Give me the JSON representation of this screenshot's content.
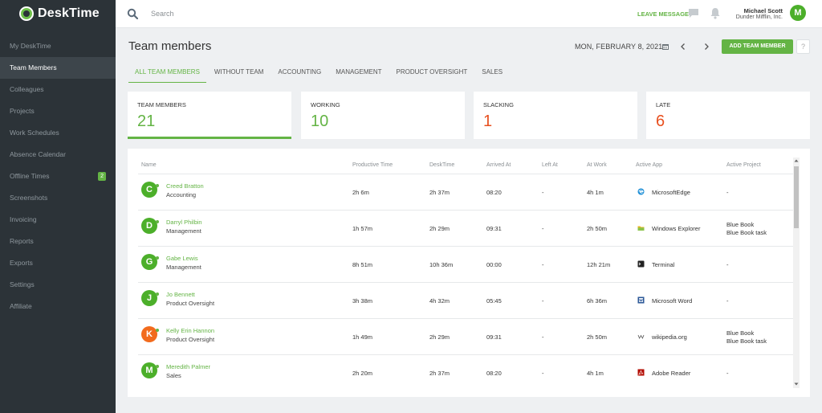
{
  "app": {
    "name": "DeskTime"
  },
  "sidebar": {
    "items": [
      {
        "label": "My DeskTime"
      },
      {
        "label": "Team Members"
      },
      {
        "label": "Colleagues"
      },
      {
        "label": "Projects"
      },
      {
        "label": "Work Schedules"
      },
      {
        "label": "Absence Calendar"
      },
      {
        "label": "Offline Times",
        "badge": "2"
      },
      {
        "label": "Screenshots"
      },
      {
        "label": "Invoicing"
      },
      {
        "label": "Reports"
      },
      {
        "label": "Exports"
      },
      {
        "label": "Settings"
      },
      {
        "label": "Affiliate"
      }
    ]
  },
  "topbar": {
    "search_placeholder": "Search",
    "leave_message": "LEAVE MESSAGE",
    "user_name": "Michael Scott",
    "user_company": "Dunder Mifflin, Inc.",
    "user_initial": "M"
  },
  "header": {
    "title": "Team members",
    "date": "MON, FEBRUARY 8, 2021",
    "add_button": "ADD TEAM MEMBER",
    "help": "?"
  },
  "tabs": [
    {
      "label": "ALL TEAM MEMBERS"
    },
    {
      "label": "WITHOUT TEAM"
    },
    {
      "label": "ACCOUNTING"
    },
    {
      "label": "MANAGEMENT"
    },
    {
      "label": "PRODUCT OVERSIGHT"
    },
    {
      "label": "SALES"
    }
  ],
  "stats": [
    {
      "label": "TEAM MEMBERS",
      "value": "21",
      "color": "#64b445"
    },
    {
      "label": "WORKING",
      "value": "10",
      "color": "#64b445"
    },
    {
      "label": "SLACKING",
      "value": "1",
      "color": "#e8501f"
    },
    {
      "label": "LATE",
      "value": "6",
      "color": "#e8501f"
    }
  ],
  "table": {
    "columns": [
      "Name",
      "Productive Time",
      "DeskTime",
      "Arrived At",
      "Left At",
      "At Work",
      "Active App",
      "Active Project"
    ],
    "rows": [
      {
        "initial": "C",
        "avatar_color": "#4caf2a",
        "name": "Creed Bratton",
        "team": "Accounting",
        "productive": "2h 6m",
        "desktime": "2h 37m",
        "arrived": "08:20",
        "left": "-",
        "at_work": "4h 1m",
        "app_icon": "edge-icon",
        "app": "MicrosoftEdge",
        "project": [
          "-"
        ]
      },
      {
        "initial": "D",
        "avatar_color": "#4caf2a",
        "name": "Darryl Philbin",
        "team": "Management",
        "productive": "1h 57m",
        "desktime": "2h 29m",
        "arrived": "09:31",
        "left": "-",
        "at_work": "2h 50m",
        "app_icon": "explorer-icon",
        "app": "Windows Explorer",
        "project": [
          "Blue Book",
          "Blue Book task"
        ]
      },
      {
        "initial": "G",
        "avatar_color": "#4caf2a",
        "name": "Gabe Lewis",
        "team": "Management",
        "productive": "8h 51m",
        "desktime": "10h 36m",
        "arrived": "00:00",
        "left": "-",
        "at_work": "12h 21m",
        "app_icon": "terminal-icon",
        "app": "Terminal",
        "project": [
          "-"
        ]
      },
      {
        "initial": "J",
        "avatar_color": "#4caf2a",
        "name": "Jo Bennett",
        "team": "Product Oversight",
        "productive": "3h 38m",
        "desktime": "4h 32m",
        "arrived": "05:45",
        "left": "-",
        "at_work": "6h 36m",
        "app_icon": "word-icon",
        "app": "Microsoft Word",
        "project": [
          "-"
        ]
      },
      {
        "initial": "K",
        "avatar_color": "#f26b1d",
        "name": "Kelly Erin Hannon",
        "team": "Product Oversight",
        "productive": "1h 49m",
        "desktime": "2h 29m",
        "arrived": "09:31",
        "left": "-",
        "at_work": "2h 50m",
        "app_icon": "wikipedia-icon",
        "app": "wikipedia.org",
        "project": [
          "Blue Book",
          "Blue Book task"
        ]
      },
      {
        "initial": "M",
        "avatar_color": "#4caf2a",
        "name": "Meredith Palmer",
        "team": "Sales",
        "productive": "2h 20m",
        "desktime": "2h 37m",
        "arrived": "08:20",
        "left": "-",
        "at_work": "4h 1m",
        "app_icon": "adobe-reader-icon",
        "app": "Adobe Reader",
        "project": [
          "-"
        ]
      }
    ]
  }
}
